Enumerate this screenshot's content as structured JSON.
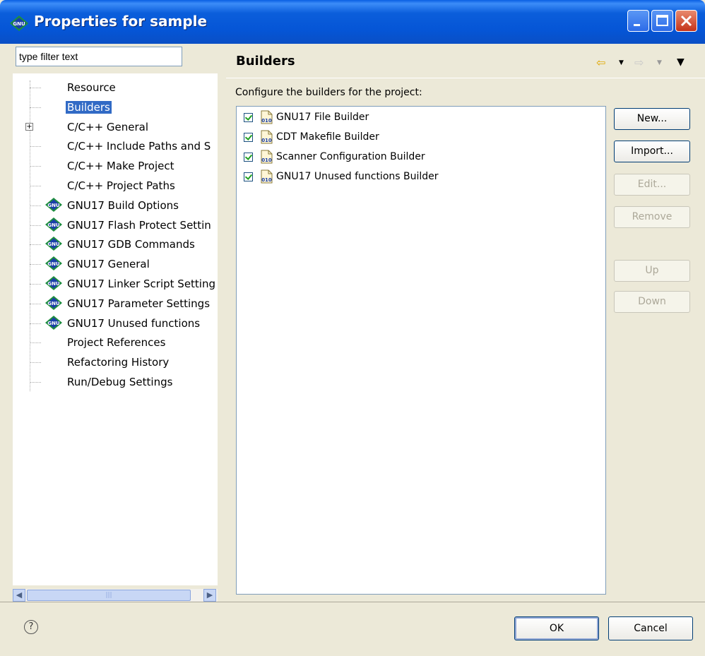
{
  "window": {
    "title": "Properties for sample",
    "app_icon": "gnu-icon",
    "controls": [
      "minimize-icon",
      "maximize-icon",
      "close-icon"
    ]
  },
  "filter": {
    "value": "type filter text"
  },
  "tree": {
    "items": [
      {
        "label": "Resource",
        "icon": "none",
        "expandable": false,
        "selected": false
      },
      {
        "label": "Builders",
        "icon": "none",
        "expandable": false,
        "selected": true
      },
      {
        "label": "C/C++ General",
        "icon": "none",
        "expandable": true,
        "selected": false
      },
      {
        "label": "C/C++ Include Paths and S",
        "icon": "none",
        "expandable": false,
        "selected": false
      },
      {
        "label": "C/C++ Make Project",
        "icon": "none",
        "expandable": false,
        "selected": false
      },
      {
        "label": "C/C++ Project Paths",
        "icon": "none",
        "expandable": false,
        "selected": false
      },
      {
        "label": "GNU17 Build Options",
        "icon": "gnu-icon",
        "expandable": false,
        "selected": false
      },
      {
        "label": "GNU17 Flash Protect Settin",
        "icon": "gnu-icon",
        "expandable": false,
        "selected": false
      },
      {
        "label": "GNU17 GDB Commands",
        "icon": "gnu-icon",
        "expandable": false,
        "selected": false
      },
      {
        "label": "GNU17 General",
        "icon": "gnu-icon",
        "expandable": false,
        "selected": false
      },
      {
        "label": "GNU17 Linker Script Setting",
        "icon": "gnu-icon",
        "expandable": false,
        "selected": false
      },
      {
        "label": "GNU17 Parameter Settings",
        "icon": "gnu-icon",
        "expandable": false,
        "selected": false
      },
      {
        "label": "GNU17 Unused functions",
        "icon": "gnu-icon",
        "expandable": false,
        "selected": false
      },
      {
        "label": "Project References",
        "icon": "none",
        "expandable": false,
        "selected": false
      },
      {
        "label": "Refactoring History",
        "icon": "none",
        "expandable": false,
        "selected": false
      },
      {
        "label": "Run/Debug Settings",
        "icon": "none",
        "expandable": false,
        "selected": false
      }
    ]
  },
  "page": {
    "title": "Builders",
    "config_label": "Configure the builders for the project:",
    "builders": [
      {
        "label": "GNU17 File Builder",
        "checked": true
      },
      {
        "label": "CDT Makefile Builder",
        "checked": true
      },
      {
        "label": "Scanner Configuration Builder",
        "checked": true
      },
      {
        "label": "GNU17 Unused functions Builder",
        "checked": true
      }
    ],
    "buttons": {
      "new": "New...",
      "import": "Import...",
      "edit": "Edit...",
      "remove": "Remove",
      "up": "Up",
      "down": "Down"
    }
  },
  "footer": {
    "help_glyph": "?",
    "ok": "OK",
    "cancel": "Cancel"
  },
  "colors": {
    "selection": "#316AC5",
    "titlebar": "#0555D6",
    "dialog_bg": "#ECE9D8"
  }
}
